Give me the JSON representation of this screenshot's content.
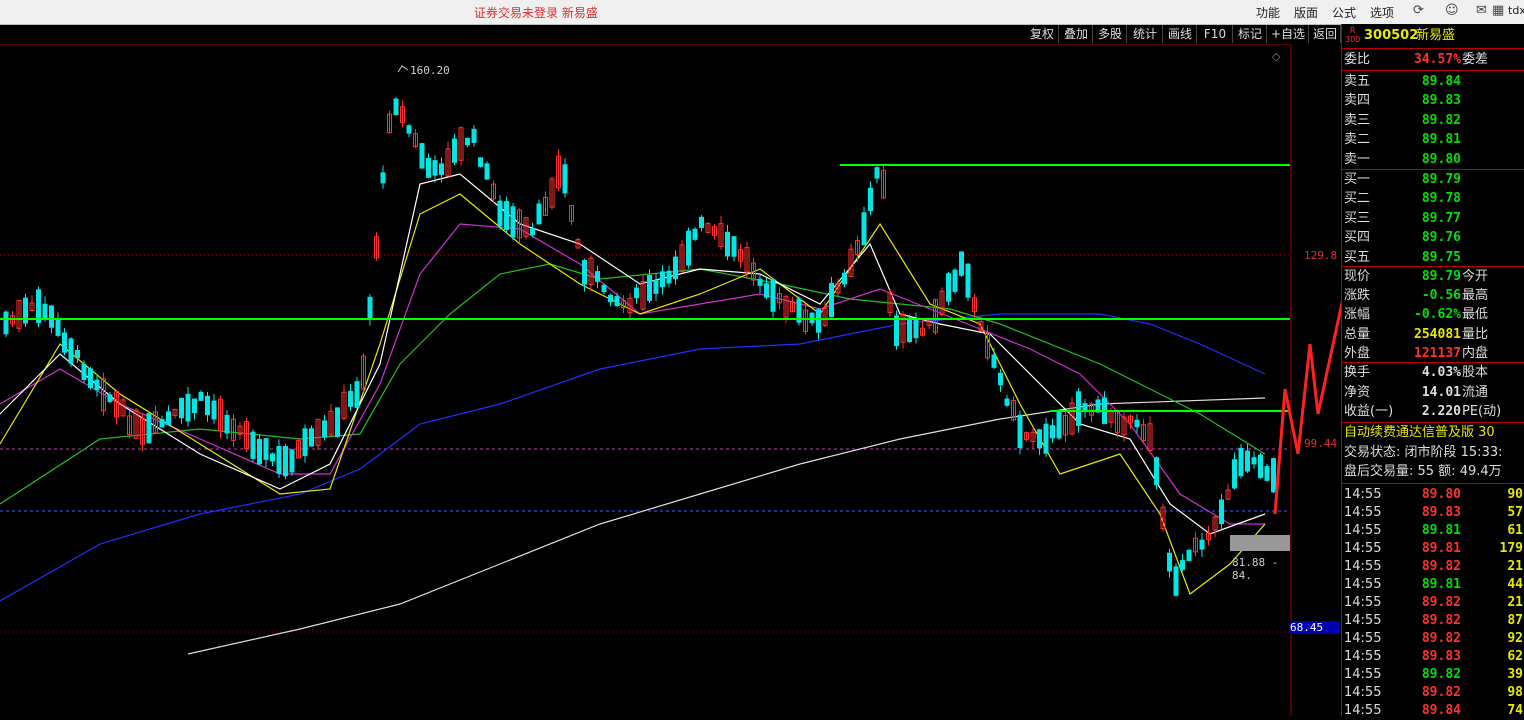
{
  "topbar": {
    "title": "证券交易未登录  新易盛",
    "menus": [
      "功能",
      "版面",
      "公式",
      "选项"
    ],
    "icons": [
      "refresh-icon",
      "person-icon",
      "mail-icon",
      "grid-icon"
    ],
    "tdx_label": "tdx"
  },
  "toolbar": [
    "复权",
    "叠加",
    "多股",
    "统计",
    "画线",
    "F10",
    "标记",
    "+自选",
    "返回"
  ],
  "chart": {
    "peak_label": "160.20",
    "price_axis": {
      "upper": "129.8",
      "middle": "99.44",
      "current": "68.45"
    },
    "range_label": "81.88 - 84."
  },
  "stock": {
    "badge_top": "R",
    "badge_bottom": "300",
    "code": "300502",
    "name": "新易盛"
  },
  "weibi": {
    "label": "委比",
    "value": "34.57%",
    "label2": "委差"
  },
  "asks": [
    {
      "label": "卖五",
      "price": "89.84"
    },
    {
      "label": "卖四",
      "price": "89.83"
    },
    {
      "label": "卖三",
      "price": "89.82"
    },
    {
      "label": "卖二",
      "price": "89.81"
    },
    {
      "label": "卖一",
      "price": "89.80"
    }
  ],
  "bids": [
    {
      "label": "买一",
      "price": "89.79"
    },
    {
      "label": "买二",
      "price": "89.78"
    },
    {
      "label": "买三",
      "price": "89.77"
    },
    {
      "label": "买四",
      "price": "89.76"
    },
    {
      "label": "买五",
      "price": "89.75"
    }
  ],
  "quote": [
    {
      "label": "现价",
      "value": "89.79",
      "label2": "今开",
      "color": "#00e000"
    },
    {
      "label": "涨跌",
      "value": "-0.56",
      "label2": "最高",
      "color": "#00e000"
    },
    {
      "label": "涨幅",
      "value": "-0.62%",
      "label2": "最低",
      "color": "#00e000"
    },
    {
      "label": "总量",
      "value": "254081",
      "label2": "量比",
      "color": "#e8e800"
    },
    {
      "label": "外盘",
      "value": "121137",
      "label2": "内盘",
      "color": "#ff3030"
    }
  ],
  "stats": [
    {
      "label": "换手",
      "value": "4.03%",
      "label2": "股本"
    },
    {
      "label": "净资",
      "value": "14.01",
      "label2": "流通"
    },
    {
      "label": "收益(一)",
      "value": "2.220",
      "label2": "PE(动)"
    }
  ],
  "banner": "自动续费通达信普及版  30",
  "trade_status": "交易状态: 闭市阶段 15:33:",
  "after_hours": "盘后交易量: 55  额: 49.4万",
  "ticks": [
    {
      "time": "14:55",
      "price": "89.80",
      "vol": "90",
      "c": "#ff3030"
    },
    {
      "time": "14:55",
      "price": "89.83",
      "vol": "57",
      "c": "#ff3030"
    },
    {
      "time": "14:55",
      "price": "89.81",
      "vol": "61",
      "c": "#00e000"
    },
    {
      "time": "14:55",
      "price": "89.81",
      "vol": "179",
      "c": "#ff3030"
    },
    {
      "time": "14:55",
      "price": "89.82",
      "vol": "21",
      "c": "#ff3030"
    },
    {
      "time": "14:55",
      "price": "89.81",
      "vol": "44",
      "c": "#00e000"
    },
    {
      "time": "14:55",
      "price": "89.82",
      "vol": "21",
      "c": "#ff3030"
    },
    {
      "time": "14:55",
      "price": "89.82",
      "vol": "87",
      "c": "#ff3030"
    },
    {
      "time": "14:55",
      "price": "89.82",
      "vol": "92",
      "c": "#ff3030"
    },
    {
      "time": "14:55",
      "price": "89.83",
      "vol": "62",
      "c": "#ff3030"
    },
    {
      "time": "14:55",
      "price": "89.82",
      "vol": "39",
      "c": "#00e000"
    },
    {
      "time": "14:55",
      "price": "89.82",
      "vol": "98",
      "c": "#ff3030"
    },
    {
      "time": "14:55",
      "price": "89.84",
      "vol": "74",
      "c": "#ff3030"
    }
  ],
  "colors": {
    "up": "#ff3030",
    "down": "#00e5e5",
    "support_line": "#00ff00",
    "ma_blue": "#2030ff"
  }
}
